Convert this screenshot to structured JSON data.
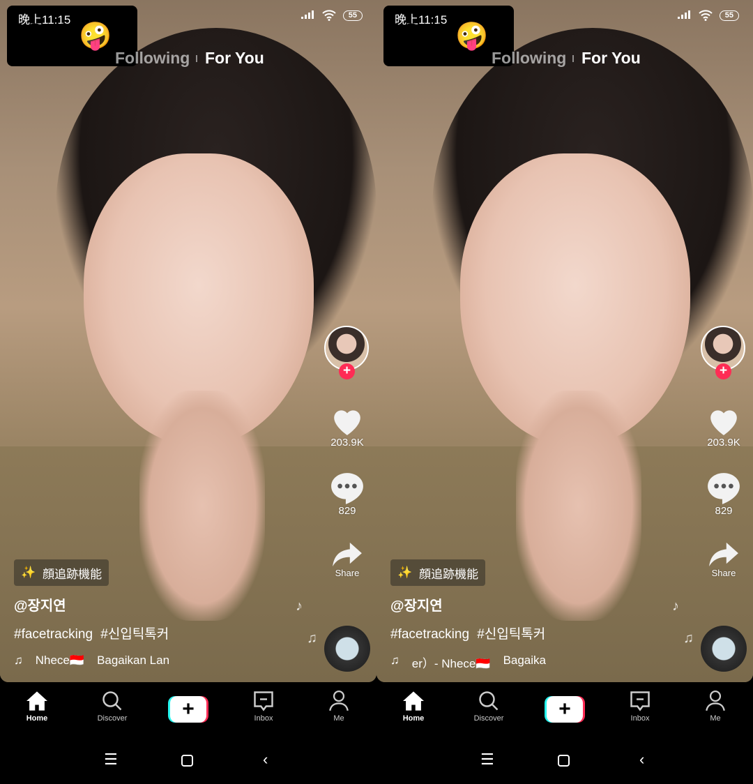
{
  "panels": [
    {
      "status": {
        "time": "晚上11:15",
        "emojis": "😗😒🤪",
        "battery": "55"
      },
      "tabs": {
        "following": "Following",
        "for_you": "For You"
      },
      "likes": "203.9K",
      "comments": "829",
      "share": "Share",
      "effect": {
        "icon": "✨",
        "label": "顔追跡機能"
      },
      "username": "@장지연",
      "hashtags": "#facetracking #신입틱톡커",
      "music": {
        "artist": "Nhece🇮🇩",
        "title": "Bagaikan Lan"
      },
      "nav": {
        "home": "Home",
        "discover": "Discover",
        "inbox": "Inbox",
        "me": "Me"
      }
    },
    {
      "status": {
        "time": "晚上11:15",
        "emojis": "😗😒🤪",
        "battery": "55"
      },
      "tabs": {
        "following": "Following",
        "for_you": "For You"
      },
      "likes": "203.9K",
      "comments": "829",
      "share": "Share",
      "effect": {
        "icon": "✨",
        "label": "顔追跡機能"
      },
      "username": "@장지연",
      "hashtags": "#facetracking #신입틱톡커",
      "music": {
        "artist": "er）- Nhece🇮🇩",
        "title": "Bagaika"
      },
      "nav": {
        "home": "Home",
        "discover": "Discover",
        "inbox": "Inbox",
        "me": "Me"
      }
    }
  ],
  "colors": {
    "accent": "#fe2c55",
    "cyan": "#25f4ee"
  }
}
